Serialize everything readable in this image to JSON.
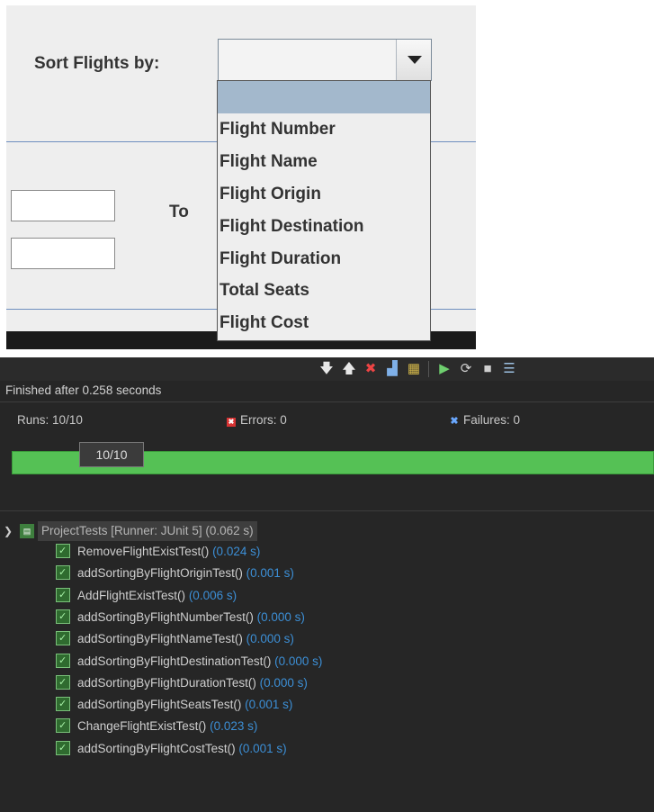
{
  "swing": {
    "sort_label": "Sort Flights by:",
    "combo_value": "",
    "to_label": "To",
    "dropdown_options": [
      "",
      "Flight Number",
      "Flight Name",
      "Flight Origin",
      "Flight Destination",
      "Flight Duration",
      "Total Seats",
      "Flight Cost"
    ]
  },
  "junit": {
    "finished_text": "Finished after 0.258 seconds",
    "runs_label": "Runs:",
    "runs_value": "10/10",
    "errors_label": "Errors:",
    "errors_value": "0",
    "failures_label": "Failures:",
    "failures_value": "0",
    "tooltip": "10/10",
    "progress_fraction": 1.0,
    "progress_color": "#55c155",
    "root": {
      "label": "ProjectTests [Runner: JUnit 5] (0.062 s)"
    },
    "tests": [
      {
        "name": "RemoveFlightExistTest()",
        "time": "(0.024 s)"
      },
      {
        "name": "addSortingByFlightOriginTest()",
        "time": "(0.001 s)"
      },
      {
        "name": "AddFlightExistTest()",
        "time": "(0.006 s)"
      },
      {
        "name": "addSortingByFlightNumberTest()",
        "time": "(0.000 s)"
      },
      {
        "name": "addSortingByFlightNameTest()",
        "time": "(0.000 s)"
      },
      {
        "name": "addSortingByFlightDestinationTest()",
        "time": "(0.000 s)"
      },
      {
        "name": "addSortingByFlightDurationTest()",
        "time": "(0.000 s)"
      },
      {
        "name": "addSortingByFlightSeatsTest()",
        "time": "(0.001 s)"
      },
      {
        "name": "ChangeFlightExistTest()",
        "time": "(0.023 s)"
      },
      {
        "name": "addSortingByFlightCostTest()",
        "time": "(0.001 s)"
      }
    ],
    "toolbar_icons": [
      "next-failure-icon",
      "previous-failure-icon",
      "show-failures-only-icon",
      "scroll-lock-icon",
      "show-skipped-icon",
      "rerun-icon",
      "rerun-failed-first-icon",
      "stop-icon",
      "history-icon"
    ]
  }
}
